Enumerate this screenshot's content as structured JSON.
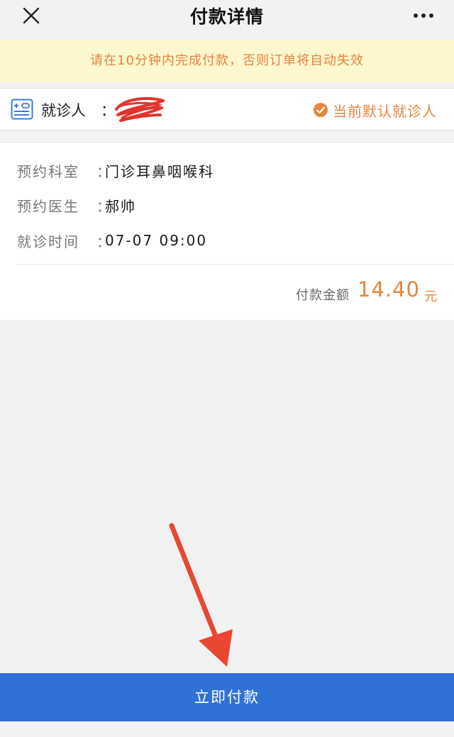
{
  "header": {
    "title": "付款详情",
    "close_icon": "close-icon",
    "more_icon": "more-icon"
  },
  "notice": {
    "text": "请在10分钟内完成付款，否则订单将自动失效"
  },
  "patient": {
    "label": "就诊人",
    "colon": "：",
    "default_text": "当前默认就诊人",
    "card_icon": "patient-card-icon",
    "check_icon": "check-circle-icon"
  },
  "details": {
    "rows": [
      {
        "label": "预约科室",
        "value": "门诊耳鼻咽喉科"
      },
      {
        "label": "预约医生",
        "value": "郝帅"
      },
      {
        "label": "就诊时间",
        "value": "07-07 09:00"
      }
    ],
    "colon": "：",
    "amount_label": "付款金额",
    "amount_value": "14.40",
    "amount_unit": "元"
  },
  "actions": {
    "pay_label": "立即付款"
  },
  "colors": {
    "accent": "#e8843c",
    "primary": "#3071d6",
    "notice_bg": "#fdf7cf",
    "background": "#f2f2f2",
    "annotation_arrow": "#e9472f"
  }
}
